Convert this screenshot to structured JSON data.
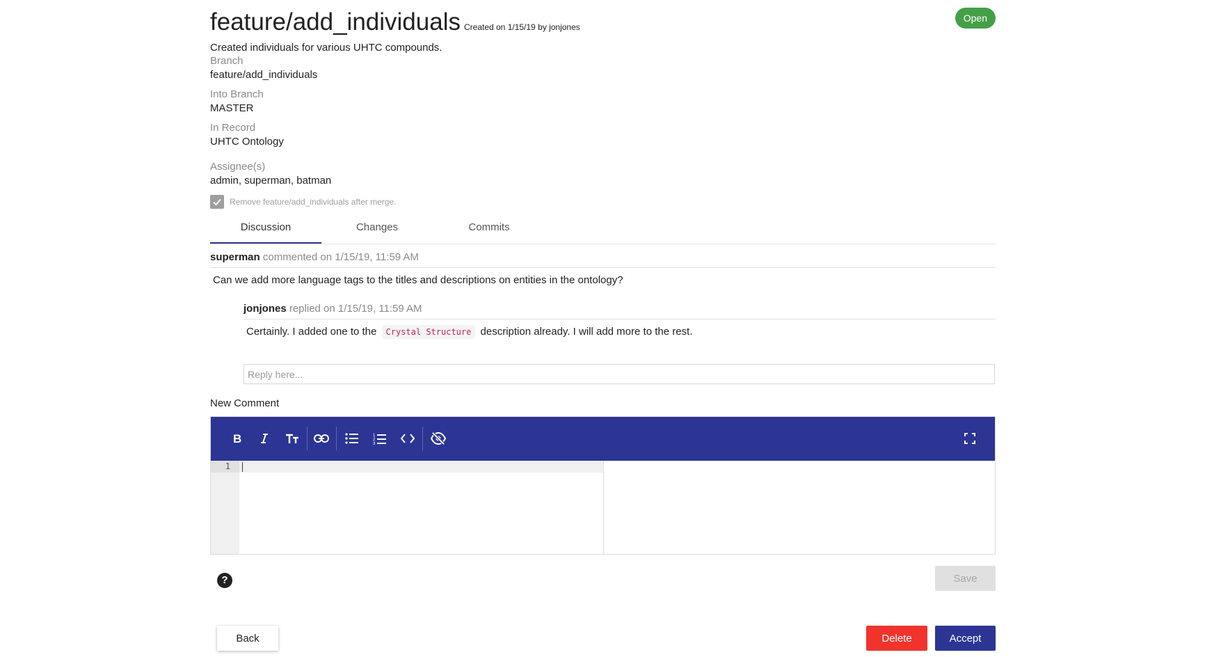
{
  "header": {
    "title": "feature/add_individuals",
    "created": "Created on 1/15/19 by jonjones",
    "status": "Open",
    "status_color": "#44a047"
  },
  "description": "Created individuals for various UHTC compounds.",
  "fields": {
    "branch_label": "Branch",
    "branch_value": "feature/add_individuals",
    "into_label": "Into Branch",
    "into_value": "MASTER",
    "record_label": "In Record",
    "record_value": "UHTC Ontology",
    "assignees_label": "Assignee(s)",
    "assignees_value": "admin, superman, batman"
  },
  "remove_branch": {
    "label": "Remove feature/add_individuals after merge.",
    "checked": true
  },
  "tabs": [
    {
      "label": "Discussion",
      "active": true
    },
    {
      "label": "Changes",
      "active": false
    },
    {
      "label": "Commits",
      "active": false
    }
  ],
  "comment": {
    "author": "superman",
    "meta": "commented on 1/15/19, 11:59 AM",
    "body": "Can we add more language tags to the titles and descriptions on entities in the ontology?"
  },
  "reply": {
    "author": "jonjones",
    "meta": "replied on 1/15/19, 11:59 AM",
    "body_before": "Certainly. I added one to the",
    "code": "Crystal Structure",
    "body_after": "description already. I will add more to the rest."
  },
  "reply_input": {
    "placeholder": "Reply here...",
    "value": ""
  },
  "new_comment": {
    "label": "New Comment",
    "toolbar": [
      "bold-icon",
      "italic-icon",
      "heading-icon",
      "link-icon",
      "bullet-list-icon",
      "numbered-list-icon",
      "code-icon",
      "preview-toggle-icon",
      "fullscreen-icon"
    ],
    "line_number": "1"
  },
  "actions": {
    "save": "Save",
    "back": "Back",
    "delete": "Delete",
    "accept": "Accept",
    "help": "?"
  },
  "colors": {
    "primary": "#2c3594",
    "danger": "#f0342c",
    "success": "#44a047"
  }
}
